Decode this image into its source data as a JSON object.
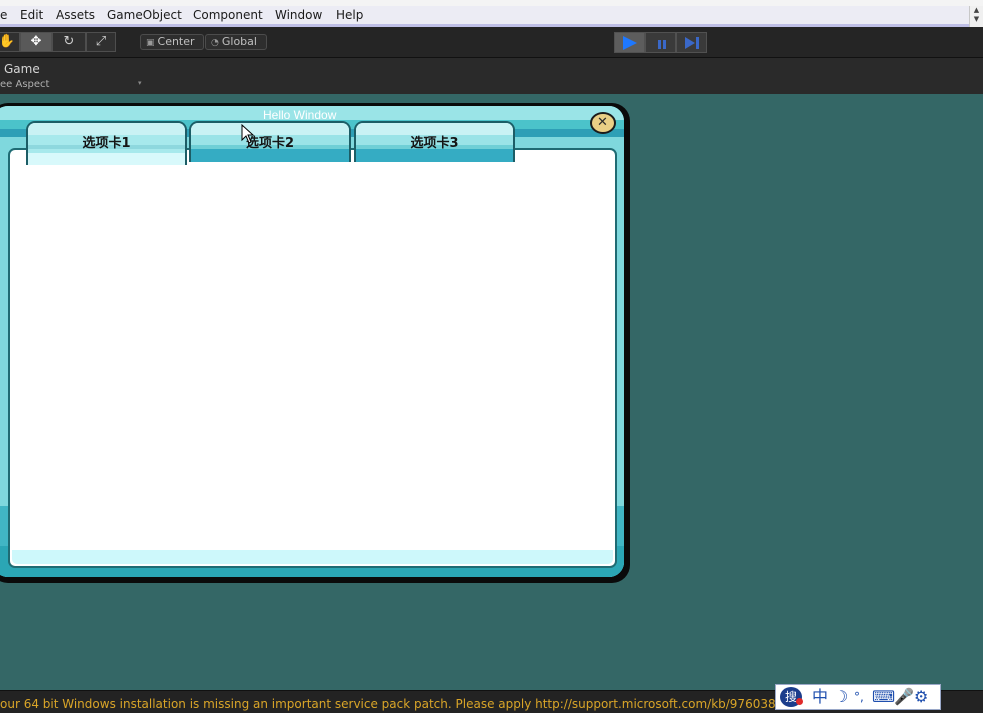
{
  "menu": {
    "items": [
      "e",
      "Edit",
      "Assets",
      "GameObject",
      "Component",
      "Window",
      "Help"
    ]
  },
  "toolbar": {
    "tools": [
      {
        "name": "hand-tool",
        "glyph": "✋"
      },
      {
        "name": "move-tool",
        "glyph": "✥"
      },
      {
        "name": "rotate-tool",
        "glyph": "↻"
      },
      {
        "name": "scale-tool",
        "glyph": "⤢"
      }
    ],
    "pivot_center": "Center",
    "pivot_global": "Global",
    "play_colors": {
      "play": "#1e78ff",
      "pause": "#3a68c8",
      "step": "#3a68c8"
    }
  },
  "game_view": {
    "tab_title": "Game",
    "aspect": "ee Aspect"
  },
  "window": {
    "title": "Hello Window",
    "close_glyph": "✕",
    "tabs": [
      "选项卡1",
      "选项卡2",
      "选项卡3"
    ],
    "active_tab": 0
  },
  "status": {
    "message": "our 64 bit Windows installation is missing an important service pack patch. Please apply http://support.microsoft.com/kb/976038 to en"
  },
  "ime": {
    "logo_char": "搜",
    "chinese_mode": "中",
    "moon": "☽",
    "punct": "°,",
    "keyboard": "⌨",
    "mic": "🎤",
    "settings": "⚙"
  },
  "colors": {
    "scene_bg": "#346766",
    "status_text": "#d9a528",
    "window_frame": "#4ec8cf"
  }
}
